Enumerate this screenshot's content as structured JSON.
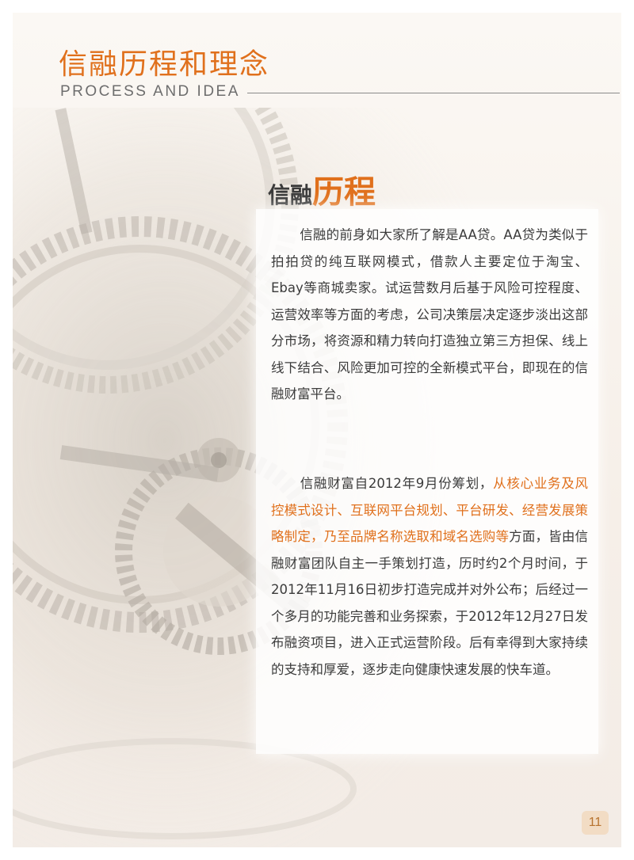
{
  "header": {
    "title": "信融历程和理念",
    "subtitle": "PROCESS AND IDEA"
  },
  "section": {
    "title_part1": "信融",
    "title_part2": "历程"
  },
  "paragraph1": {
    "text": "信融的前身如大家所了解是AA贷。AA贷为类似于拍拍贷的纯互联网模式，借款人主要定位于淘宝、Ebay等商城卖家。试运营数月后基于风险可控程度、运营效率等方面的考虑，公司决策层决定逐步淡出这部分市场，将资源和精力转向打造独立第三方担保、线上线下结合、风险更加可控的全新模式平台，即现在的信融财富平台。"
  },
  "paragraph2": {
    "part1": "信融财富自2012年9月份筹划，",
    "highlight": "从核心业务及风控模式设计、互联网平台规划、平台研发、经营发展策略制定，乃至品牌名称选取和域名选购等",
    "part2": "方面，皆由信融财富团队自主一手策划打造，历时约2个月时间，于2012年11月16日初步打造完成并对外公布；后经过一个多月的功能完善和业务探索，于2012年12月27日发布融资项目，进入正式运营阶段。后有幸得到大家持续的支持和厚爱，逐步走向健康快速发展的快车道。"
  },
  "footer": {
    "page_number": "11"
  },
  "colors": {
    "accent": "#e0701c",
    "text": "#3b3b3b"
  }
}
